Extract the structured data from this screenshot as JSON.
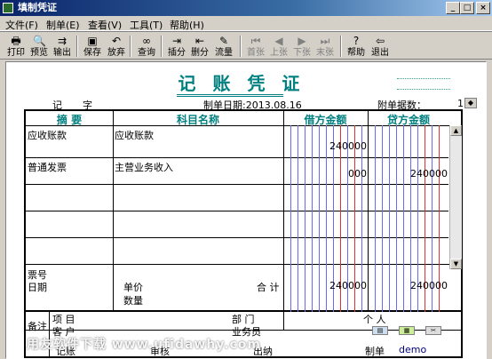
{
  "window": {
    "title": "填制凭证",
    "buttons": {
      "minimize": "_",
      "maximize": "□",
      "close": "×"
    }
  },
  "menu": [
    "文件(F)",
    "制单(E)",
    "查看(V)",
    "工具(T)",
    "帮助(H)"
  ],
  "toolbar": [
    {
      "label": "打印",
      "icon": "printer-icon",
      "glyph": "🖶"
    },
    {
      "label": "预览",
      "icon": "preview-icon",
      "glyph": "🔍"
    },
    {
      "label": "输出",
      "icon": "export-icon",
      "glyph": "⇉"
    },
    {
      "label": "保存",
      "icon": "save-icon",
      "glyph": "▣"
    },
    {
      "label": "放弃",
      "icon": "undo-icon",
      "glyph": "↶"
    },
    {
      "label": "查询",
      "icon": "binoculars-icon",
      "glyph": "∞"
    },
    {
      "label": "插分",
      "icon": "insert-row-icon",
      "glyph": "⇥"
    },
    {
      "label": "删分",
      "icon": "delete-row-icon",
      "glyph": "⇤"
    },
    {
      "label": "流量",
      "icon": "cashflow-icon",
      "glyph": "✎"
    },
    {
      "label": "首张",
      "icon": "first-icon",
      "glyph": "⏮"
    },
    {
      "label": "上张",
      "icon": "prev-icon",
      "glyph": "◀"
    },
    {
      "label": "下张",
      "icon": "next-icon",
      "glyph": "▶"
    },
    {
      "label": "末张",
      "icon": "last-icon",
      "glyph": "⏭"
    },
    {
      "label": "帮助",
      "icon": "help-icon",
      "glyph": "?"
    },
    {
      "label": "退出",
      "icon": "exit-icon",
      "glyph": "⇦"
    }
  ],
  "voucher": {
    "title": "记 账 凭 证",
    "type_label": "记",
    "word_label": "字",
    "date_label": "制单日期:2013.08.16",
    "attach_label": "附单据数：",
    "attach_value": "1",
    "headers": {
      "summary": "摘 要",
      "account": "科目名称",
      "debit": "借方金额",
      "credit": "贷方金额"
    },
    "rows": [
      {
        "summary": "应收账款",
        "account": "应收账款",
        "debit": "240000",
        "credit": ""
      },
      {
        "summary": "普通发票",
        "account": "主营业务收入",
        "debit": "000",
        "credit": "240000"
      },
      {
        "summary": "",
        "account": "",
        "debit": "",
        "credit": ""
      },
      {
        "summary": "",
        "account": "",
        "debit": "",
        "credit": ""
      },
      {
        "summary": "",
        "account": "",
        "debit": "",
        "credit": ""
      }
    ],
    "footer": {
      "ticket": "票号",
      "date": "日期",
      "unit_price": "单价",
      "quantity": "数量",
      "total_label": "合 计",
      "total_debit": "240000",
      "total_credit": "240000",
      "remark": "备注",
      "project": "项    目",
      "customer": "客    户",
      "dept": "部    门",
      "salesman": "业务员",
      "person": "个    人"
    },
    "signatures": {
      "bookkeep": "记账",
      "audit": "审核",
      "cashier": "出纳",
      "maker_label": "制单",
      "maker": "demo"
    }
  },
  "watermark": "用友软件下载 www.ufidawhy.com"
}
